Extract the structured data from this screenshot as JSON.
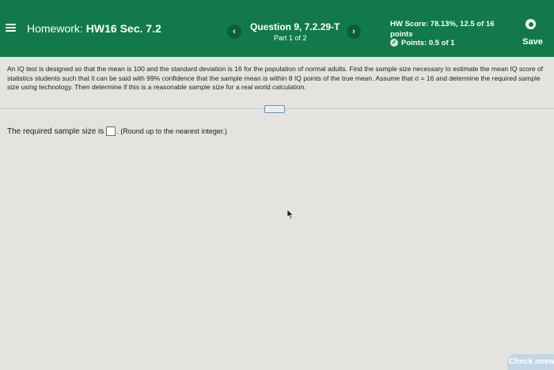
{
  "header": {
    "homework_label": "Homework:",
    "homework_name": "HW16 Sec. 7.2",
    "question_title": "Question 9, 7.2.29-T",
    "question_part": "Part 1 of 2",
    "prev_icon": "‹",
    "next_icon": "›",
    "score_text": "HW Score: 78.13%, 12.5 of 16 points",
    "points_text": "Points: 0.5 of 1",
    "save_label": "Save",
    "accent_color": "#127a4a"
  },
  "question": {
    "body": "An IQ test is designed so that the mean is 100 and the standard deviation is 16 for the population of normal adults. Find the sample size necessary to estimate the mean IQ score of statistics students such that it can be said with 99% confidence that the sample mean is within 8 IQ points of the true mean. Assume that σ = 16 and determine the required sample size using technology. Then determine if this is a reasonable sample size for a real world calculation.",
    "more_label": "·····"
  },
  "answer": {
    "prefix": "The required sample size is",
    "value": "",
    "suffix": ". (Round up to the nearest integer.)"
  },
  "footer": {
    "check_answer_label": "Check answ"
  }
}
